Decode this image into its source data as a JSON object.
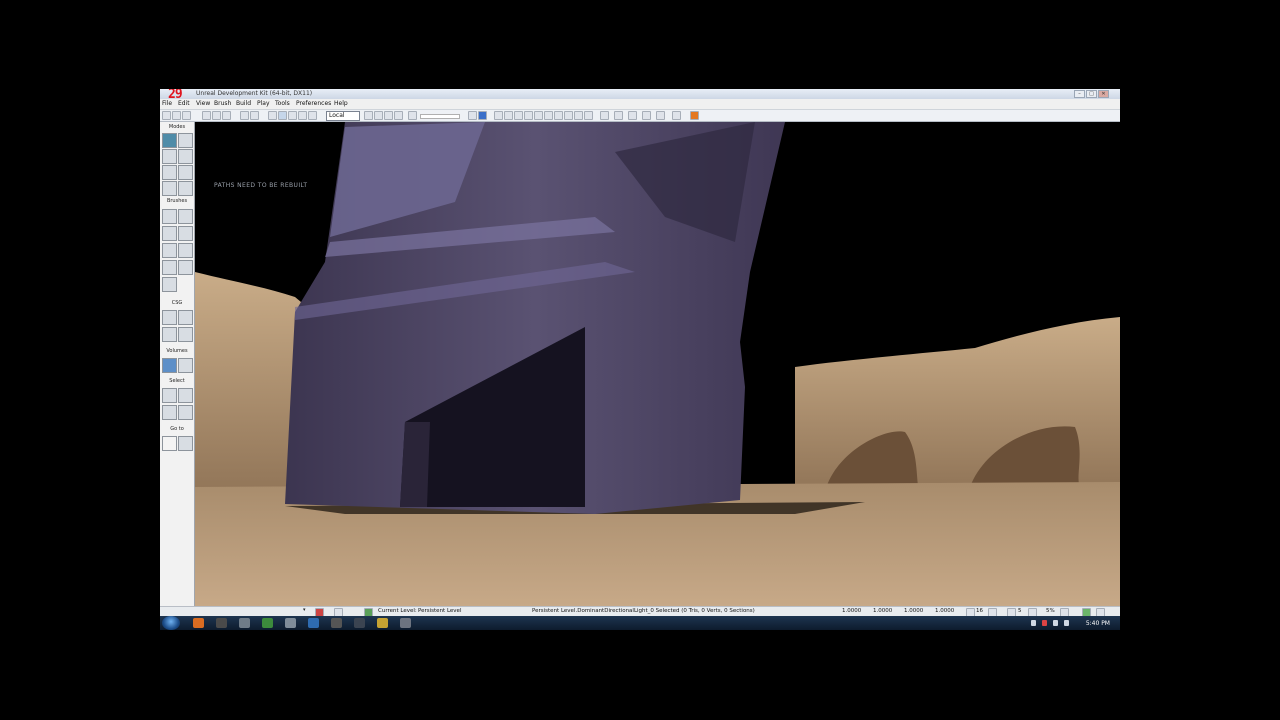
{
  "window": {
    "fps": "29",
    "title": "Unreal Development Kit (64-bit, DX11)",
    "controls": [
      "–",
      "□",
      "✕"
    ]
  },
  "menu": [
    "File",
    "Edit",
    "View",
    "Brush",
    "Build",
    "Play",
    "Tools",
    "Preferences",
    "Help"
  ],
  "toolbar": {
    "coord_system": "Local"
  },
  "left_panel": {
    "sections": {
      "modes": "Modes",
      "brushes": "Brushes",
      "csg": "CSG",
      "volumes": "Volumes",
      "select": "Select",
      "goto": "Go to"
    }
  },
  "viewport": {
    "warning": "PATHS NEED TO BE REBUILT"
  },
  "status": {
    "current_level_label": "Current Level:",
    "current_level_value": "Persistent Level",
    "selection": "Persistent Level.DominantDirectionalLight_0 Selected (0 Tris, 0 Verts, 0 Sections)",
    "drag_values": [
      "1.0000",
      "1.0000",
      "1.0000",
      "1.0000"
    ],
    "grid": "16",
    "rot": "5",
    "scale": "5%"
  },
  "taskbar": {
    "clock": "5:40 PM"
  },
  "colors": {
    "fps": "#e0141e",
    "sand": "#b89873",
    "structure": "#4e4563",
    "sky": "#000000"
  }
}
